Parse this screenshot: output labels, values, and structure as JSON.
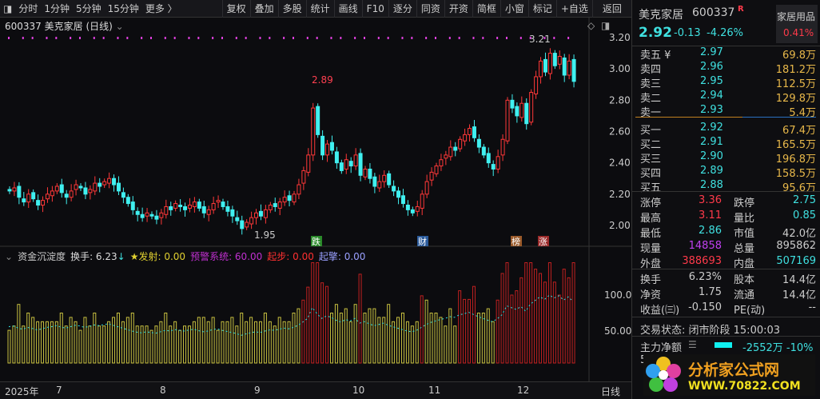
{
  "toolbar": {
    "periods": [
      "分时",
      "1分钟",
      "5分钟",
      "15分钟",
      "更多 〉"
    ],
    "buttons": [
      "复权",
      "叠加",
      "多股",
      "统计",
      "画线",
      "F10",
      "逐分",
      "同资",
      "开资",
      "简框",
      "小窗",
      "标记",
      "+自选",
      "返回"
    ]
  },
  "chart_title": "600337 美克家居 (日线)",
  "price_axis": [
    "3.20",
    "3.00",
    "2.80",
    "2.60",
    "2.40",
    "2.20",
    "2.00"
  ],
  "annotations": {
    "high_label": "2.89",
    "low_label": "1.95",
    "peak_label": "3.21"
  },
  "markers": [
    {
      "text": "跌",
      "color": "#2a8a2a"
    },
    {
      "text": "财",
      "color": "#2a5a9a"
    },
    {
      "text": "榜",
      "color": "#9a5a2a"
    },
    {
      "text": "涨",
      "color": "#9a2a2a"
    }
  ],
  "indicator": {
    "name": "资金沉淀度",
    "turnover": "换手: 6.23",
    "fire": "★发射: 0.00",
    "warn": "预警系统: 60.00",
    "start": "起步: 0.00",
    "rise": "起擎: 0.00",
    "axis": [
      "100.0",
      "50.00"
    ]
  },
  "time_axis": [
    "2025年",
    "7",
    "8",
    "9",
    "10",
    "11",
    "12",
    "日线"
  ],
  "chart_data": {
    "type": "candlestick",
    "ylim": [
      1.9,
      3.25
    ],
    "closes": [
      2.22,
      2.24,
      2.18,
      2.15,
      2.2,
      2.17,
      2.13,
      2.16,
      2.2,
      2.22,
      2.25,
      2.21,
      2.18,
      2.22,
      2.26,
      2.24,
      2.2,
      2.23,
      2.27,
      2.25,
      2.28,
      2.3,
      2.26,
      2.22,
      2.18,
      2.14,
      2.1,
      2.07,
      2.05,
      2.08,
      2.06,
      2.04,
      2.08,
      2.12,
      2.1,
      2.14,
      2.12,
      2.1,
      2.13,
      2.15,
      2.11,
      2.08,
      2.1,
      2.14,
      2.16,
      2.12,
      2.09,
      2.06,
      2.03,
      1.98,
      2.02,
      2.05,
      2.08,
      2.06,
      2.1,
      2.13,
      2.12,
      2.15,
      2.18,
      2.16,
      2.2,
      2.26,
      2.35,
      2.45,
      2.75,
      2.58,
      2.45,
      2.52,
      2.48,
      2.4,
      2.35,
      2.42,
      2.38,
      2.45,
      2.32,
      2.36,
      2.3,
      2.25,
      2.28,
      2.32,
      2.26,
      2.22,
      2.18,
      2.14,
      2.1,
      2.08,
      2.12,
      2.2,
      2.28,
      2.34,
      2.38,
      2.42,
      2.45,
      2.5,
      2.48,
      2.55,
      2.58,
      2.62,
      2.56,
      2.5,
      2.45,
      2.4,
      2.36,
      2.44,
      2.55,
      2.8,
      2.75,
      2.7,
      2.78,
      2.65,
      2.85,
      2.95,
      3.05,
      2.98,
      3.1,
      3.02,
      3.08,
      2.96,
      3.05,
      2.92
    ]
  },
  "quote": {
    "name": "美克家居",
    "code": "600337",
    "badge": "R",
    "price": "2.92",
    "change": "-0.13",
    "pct": "-4.26%",
    "sector": "家居用品",
    "sector_pct": "0.41%"
  },
  "asks": [
    {
      "l": "卖五 ¥",
      "p": "2.97",
      "v": "69.8万"
    },
    {
      "l": "卖四",
      "p": "2.96",
      "v": "181.2万"
    },
    {
      "l": "卖三",
      "p": "2.95",
      "v": "112.5万"
    },
    {
      "l": "卖二",
      "p": "2.94",
      "v": "129.8万"
    },
    {
      "l": "卖一",
      "p": "2.93",
      "v": "5.4万"
    }
  ],
  "bids": [
    {
      "l": "买一",
      "p": "2.92",
      "v": "67.4万"
    },
    {
      "l": "买二",
      "p": "2.91",
      "v": "165.5万"
    },
    {
      "l": "买三",
      "p": "2.90",
      "v": "196.8万"
    },
    {
      "l": "买四",
      "p": "2.89",
      "v": "158.5万"
    },
    {
      "l": "买五",
      "p": "2.88",
      "v": "95.6万"
    }
  ],
  "stats": [
    [
      "涨停",
      "3.36",
      "跌停",
      "2.75"
    ],
    [
      "最高",
      "3.11",
      "量比",
      "0.85"
    ],
    [
      "最低",
      "2.86",
      "市值",
      "42.0亿"
    ],
    [
      "现量",
      "14858",
      "总量",
      "895862"
    ],
    [
      "外盘",
      "388693",
      "内盘",
      "507169"
    ]
  ],
  "stats2": [
    [
      "换手",
      "6.23%",
      "股本",
      "14.4亿"
    ],
    [
      "净资",
      "1.75",
      "流通",
      "14.4亿"
    ],
    [
      "收益(㈢)",
      "-0.150",
      "PE(动)",
      "--"
    ]
  ],
  "status": "交易状态: 闭市阶段 15:00:03",
  "flow": {
    "label": "主力净额",
    "value": "-2552万 -10%",
    "row5": "5E"
  },
  "watermark": {
    "brand": "分析家公式网",
    "url": "WWW.70822.COM"
  }
}
